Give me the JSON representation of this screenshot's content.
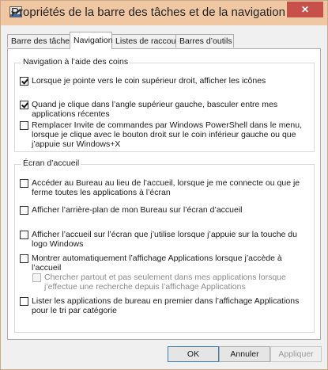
{
  "window": {
    "title": "Propriétés de la barre des tâches et de la navigation",
    "close_label": "✕"
  },
  "tabs": [
    {
      "label": "Barre des tâches"
    },
    {
      "label": "Navigation",
      "active": true
    },
    {
      "label": "Listes de raccourcis"
    },
    {
      "label": "Barres d’outils"
    }
  ],
  "corners": {
    "title": "Navigation à l’aide des coins",
    "options": [
      {
        "label": "Lorsque je pointe vers le coin supérieur droit, afficher les icônes",
        "checked": true,
        "enabled": true
      },
      {
        "label": "Quand je clique dans l’angle supérieur gauche, basculer entre mes applications récentes",
        "checked": true,
        "enabled": true
      },
      {
        "label": "Remplacer Invite de commandes par Windows PowerShell dans le menu, lorsque je clique avec le bouton droit sur le coin inférieur gauche ou que j’appuie sur Windows+X",
        "checked": false,
        "enabled": true
      }
    ]
  },
  "start": {
    "title": "Écran d’accueil",
    "options": [
      {
        "label": "Accéder au Bureau au lieu de l’accueil, lorsque je me connecte ou que je ferme toutes les applications à l’écran",
        "checked": false,
        "enabled": true
      },
      {
        "label": "Afficher l’arrière-plan de mon Bureau sur l’écran d’accueil",
        "checked": false,
        "enabled": true
      },
      {
        "label": "Afficher l’accueil sur l’écran que j’utilise lorsque j’appuie sur la touche du logo Windows",
        "checked": false,
        "enabled": true
      },
      {
        "label": "Montrer automatiquement l’affichage Applications lorsque j’accède à l’accueil",
        "checked": false,
        "enabled": true
      },
      {
        "label": "Chercher partout et pas seulement dans mes applications lorsque j’effectue une recherche depuis l’affichage Applications",
        "checked": false,
        "enabled": false
      },
      {
        "label": "Lister les applications de bureau en premier dans l’affichage Applications pour le tri par catégorie",
        "checked": false,
        "enabled": true
      }
    ]
  },
  "buttons": {
    "ok": "OK",
    "cancel": "Annuler",
    "apply": "Appliquer"
  }
}
